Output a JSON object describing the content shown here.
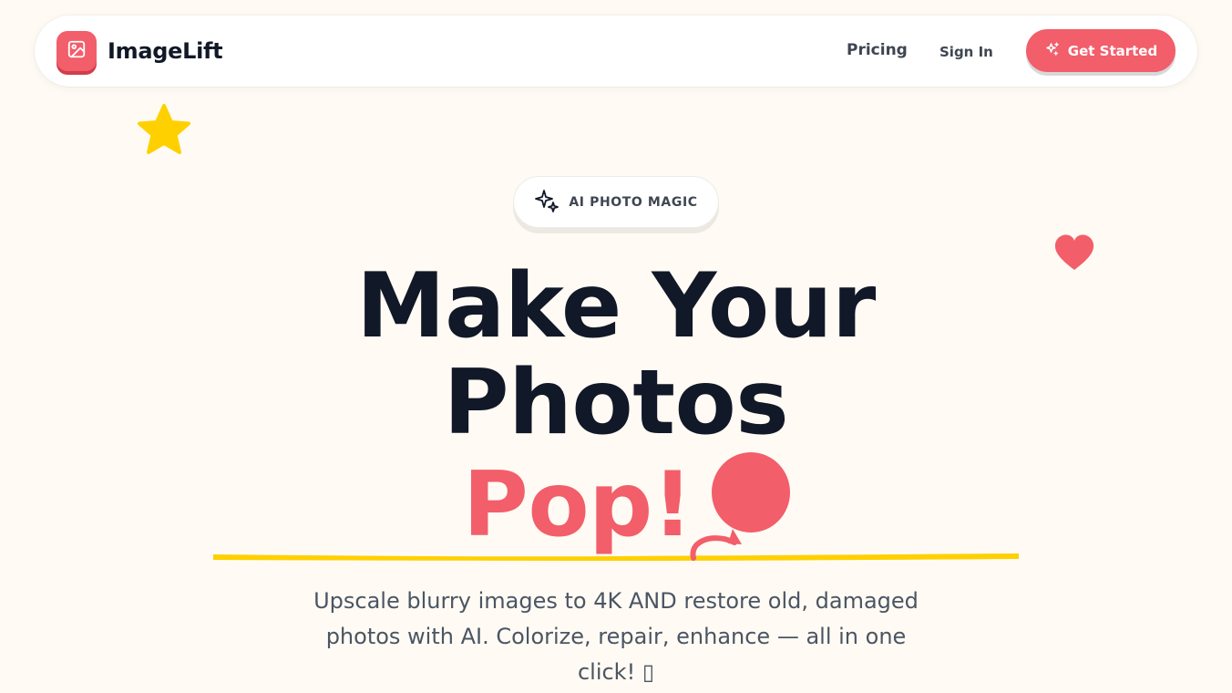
{
  "nav": {
    "brand": "ImageLift",
    "links": [
      {
        "label": "Pricing"
      },
      {
        "label": "Sign In"
      }
    ],
    "cta_label": "Get Started"
  },
  "hero": {
    "badge": "AI PHOTO MAGIC",
    "headline_line1": "Make Your",
    "headline_line2": "Photos",
    "headline_line3": "Pop!",
    "subtitle": "Upscale blurry images to 4K AND restore old, damaged photos with AI. Colorize, repair, enhance — all in one click! ▯"
  },
  "colors": {
    "accent": "#F25E6A",
    "star": "#FFD000",
    "underline": "#FFD000",
    "text_dark": "#111827",
    "text_muted": "#4B5563",
    "background": "#FFFBF4"
  },
  "icons": {
    "logo": "image-icon",
    "cta": "sparkles-icon",
    "badge": "sparkles-outline-icon",
    "decor": [
      "star-icon",
      "heart-icon",
      "balloon-icon"
    ]
  }
}
